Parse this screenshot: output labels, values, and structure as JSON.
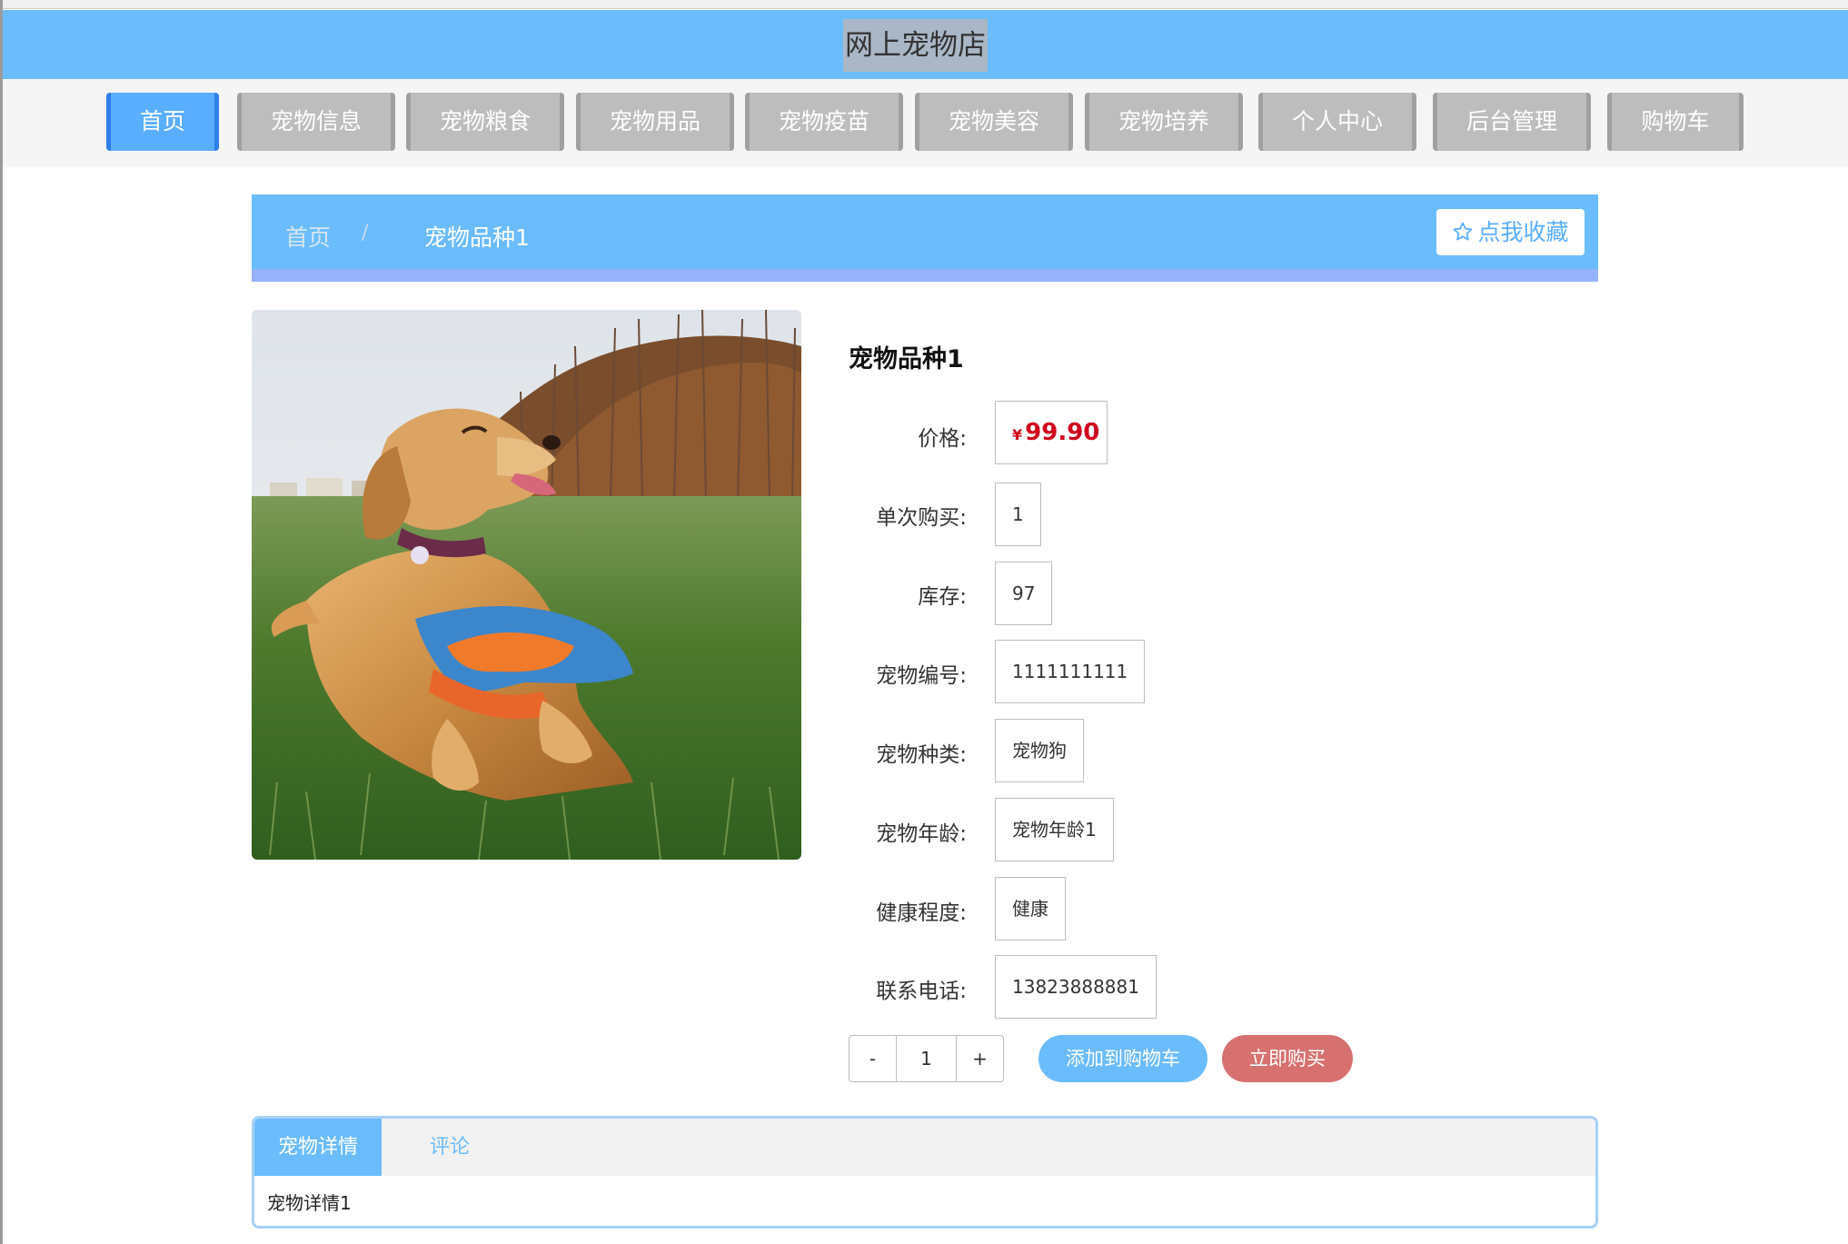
{
  "header": {
    "site_title": "网上宠物店"
  },
  "nav": {
    "items": [
      {
        "label": "首页",
        "active": true
      },
      {
        "label": "宠物信息"
      },
      {
        "label": "宠物粮食"
      },
      {
        "label": "宠物用品"
      },
      {
        "label": "宠物疫苗"
      },
      {
        "label": "宠物美容"
      },
      {
        "label": "宠物培养"
      },
      {
        "label": "个人中心"
      },
      {
        "label": "后台管理"
      },
      {
        "label": "购物车"
      }
    ]
  },
  "breadcrumb": {
    "home": "首页",
    "separator": "/",
    "current": "宠物品种1"
  },
  "favorite": {
    "icon": "star-outline-icon",
    "label": "点我收藏"
  },
  "product": {
    "title": "宠物品种1",
    "price_label": "价格:",
    "currency": "¥",
    "price": "99.90",
    "fields": [
      {
        "label": "单次购买:",
        "value": "1"
      },
      {
        "label": "库存:",
        "value": "97"
      },
      {
        "label": "宠物编号:",
        "value": "1111111111"
      },
      {
        "label": "宠物种类:",
        "value": "宠物狗"
      },
      {
        "label": "宠物年龄:",
        "value": "宠物年龄1"
      },
      {
        "label": "健康程度:",
        "value": "健康"
      },
      {
        "label": "联系电话:",
        "value": "13823888881"
      }
    ]
  },
  "actions": {
    "minus": "-",
    "quantity": "1",
    "plus": "+",
    "add_to_cart": "添加到购物车",
    "buy_now": "立即购买"
  },
  "tabs": {
    "items": [
      {
        "label": "宠物详情",
        "active": true
      },
      {
        "label": "评论"
      }
    ],
    "content": "宠物详情1"
  },
  "colors": {
    "primary": "#6bbcfd",
    "nav_active": "#5aaeff",
    "nav_inactive": "#bdbdbd",
    "price": "#d0021b",
    "buy_button": "#d77170"
  }
}
